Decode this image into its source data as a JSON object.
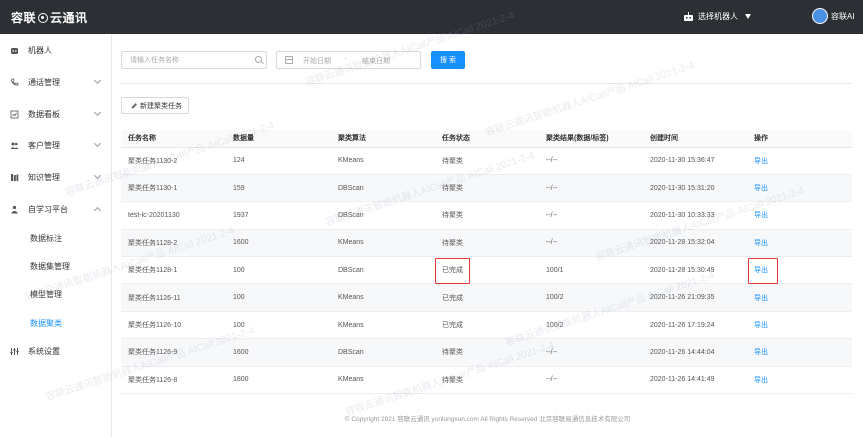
{
  "brand": {
    "name_left": "容联",
    "name_right": "云通讯"
  },
  "topbar": {
    "robot_select": "选择机器人",
    "user_name": "容联AI"
  },
  "sidebar": {
    "items": [
      {
        "label": "机器人",
        "icon": "robot-icon"
      },
      {
        "label": "通话管理",
        "icon": "phone-icon"
      },
      {
        "label": "数据看板",
        "icon": "dashboard-icon"
      },
      {
        "label": "客户管理",
        "icon": "users-icon"
      },
      {
        "label": "知识管理",
        "icon": "book-icon"
      },
      {
        "label": "自学习平台",
        "icon": "learning-icon"
      },
      {
        "label": "系统设置",
        "icon": "settings-icon"
      }
    ],
    "subitems": [
      {
        "label": "数据标注"
      },
      {
        "label": "数据集管理"
      },
      {
        "label": "模型管理"
      },
      {
        "label": "数据聚类"
      }
    ]
  },
  "filters": {
    "task_placeholder": "请输入任务名称",
    "start_date": "开始日期",
    "date_sep": "-",
    "end_date": "结束日期",
    "search_label": "搜 索"
  },
  "toolbar": {
    "new_task_label": "新建聚类任务"
  },
  "table": {
    "headers": [
      "任务名称",
      "数据量",
      "聚类算法",
      "任务状态",
      "聚类结果(数据/标签)",
      "创建时间",
      "操作"
    ],
    "rows": [
      [
        "聚类任务1130-2",
        "124",
        "KMeans",
        "待聚类",
        "--/--",
        "2020-11-30 15:36:47",
        "导出"
      ],
      [
        "聚类任务1130-1",
        "159",
        "DBScan",
        "待聚类",
        "--/--",
        "2020-11-30 15:31:20",
        "导出"
      ],
      [
        "test-lc-20201130",
        "1937",
        "DBScan",
        "待聚类",
        "--/--",
        "2020-11-30 10:33:33",
        "导出"
      ],
      [
        "聚类任务1128-2",
        "1600",
        "KMeans",
        "待聚类",
        "--/--",
        "2020-11-28 15:32:04",
        "导出"
      ],
      [
        "聚类任务1128-1",
        "100",
        "DBScan",
        "已完成",
        "100/1",
        "2020-11-28 15:30:49",
        "导出"
      ],
      [
        "聚类任务1126-11",
        "100",
        "KMeans",
        "已完成",
        "100/2",
        "2020-11-26 21:09:35",
        "导出"
      ],
      [
        "聚类任务1126-10",
        "100",
        "KMeans",
        "已完成",
        "100/2",
        "2020-11-26 17:19:24",
        "导出"
      ],
      [
        "聚类任务1126-9",
        "1600",
        "DBScan",
        "待聚类",
        "--/--",
        "2020-11-26 14:44:04",
        "导出"
      ],
      [
        "聚类任务1126-8",
        "1800",
        "KMeans",
        "待聚类",
        "--/--",
        "2020-11-26 14:41:49",
        "导出"
      ]
    ]
  },
  "footer": {
    "text": "© Copyright 2021   容联云通讯   yunlongxun.com   All Rights Reserved  北京容联易通信息技术有限公司"
  },
  "watermark": {
    "text": "容联云通讯智能机器人AICall产品  AICall  2021-2-4"
  },
  "colors": {
    "accent": "#1890ff",
    "highlight": "#e53935",
    "topbar": "#2c2f33"
  }
}
